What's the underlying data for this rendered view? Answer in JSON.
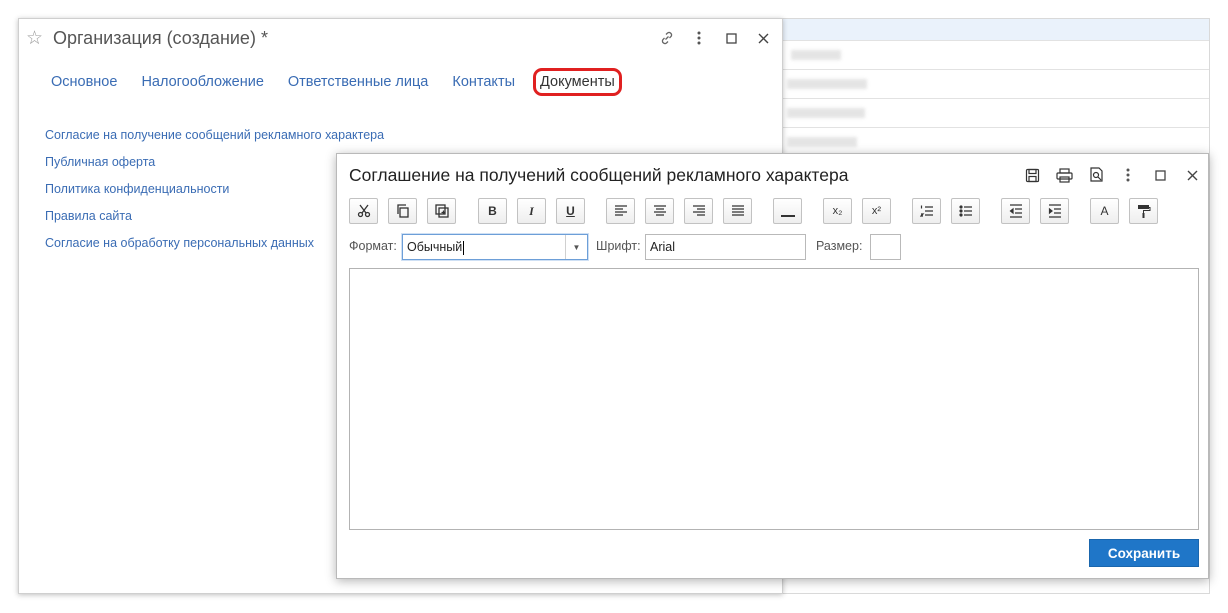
{
  "org_window": {
    "title": "Организация (создание) *",
    "tabs": [
      {
        "label": "Основное"
      },
      {
        "label": "Налогообложение"
      },
      {
        "label": "Ответственные лица"
      },
      {
        "label": "Контакты"
      },
      {
        "label": "Документы",
        "active": true
      }
    ],
    "doc_links": [
      {
        "label": "Согласие на получение сообщений рекламного характера"
      },
      {
        "label": "Публичная оферта"
      },
      {
        "label": "Политика конфиденциальности"
      },
      {
        "label": "Правила сайта"
      },
      {
        "label": "Согласие на обработку персональных данных"
      }
    ]
  },
  "dialog": {
    "title": "Соглашение на получений сообщений рекламного характера",
    "toolbar": {
      "bold": "B",
      "italic": "I",
      "underline": "U",
      "subscript": "x₂",
      "superscript": "x²",
      "font_color": "A"
    },
    "format_label": "Формат:",
    "format_value": "Обычный",
    "font_label": "Шрифт:",
    "font_value": "Arial",
    "size_label": "Размер:",
    "size_value": "",
    "save_label": "Сохранить"
  },
  "colors": {
    "link": "#3a6cb4",
    "active_tab_outline": "#e02020",
    "primary_button": "#1f76c8"
  }
}
